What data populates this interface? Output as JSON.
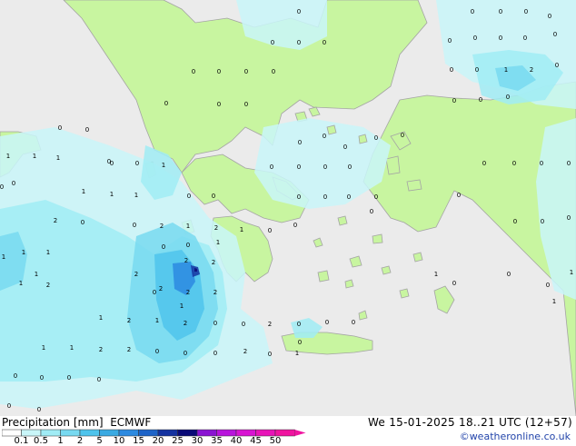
{
  "title": "Precipitation [mm]",
  "model": "ECMWF",
  "datetime": "We 15-01-2025 18..21 UTC (12+57)",
  "credit": "©weatheronline.co.uk",
  "colors": {
    "sea": "#ebebeb",
    "land": "#c8f5a0",
    "coast": "#a4a4a4",
    "prec_levels": [
      "#ffffff",
      "#c9f6f9",
      "#a0ecf5",
      "#78d9f0",
      "#4fc4ec",
      "#3aaae2",
      "#2c8ae0",
      "#1e64c8",
      "#1432a0",
      "#0a0a78",
      "#8a14d2",
      "#b814dc",
      "#d814d2",
      "#e814b8",
      "#f014a0"
    ]
  },
  "legend": {
    "labels": [
      "0.1",
      "0.5",
      "1",
      "2",
      "5",
      "10",
      "15",
      "20",
      "25",
      "30",
      "35",
      "40",
      "45",
      "50"
    ]
  },
  "map_values": {
    "marks": [
      "0",
      "0",
      "0",
      "0",
      "0",
      "0",
      "0",
      "0",
      "0",
      "0",
      "0",
      "0",
      "0",
      "0",
      "0",
      "0",
      "0",
      "0",
      "0",
      "1",
      "2",
      "0",
      "0",
      "0",
      "0",
      "0",
      "0",
      "0",
      "0",
      "0",
      "0",
      "0",
      "0",
      "0",
      "0",
      "0",
      "0",
      "0",
      "0",
      "0",
      "0",
      "0",
      "0",
      "0",
      "0",
      "0",
      "0",
      "0",
      "1",
      "1",
      "0",
      "0",
      "1",
      "1",
      "1",
      "0",
      "1",
      "0",
      "0",
      "2",
      "1",
      "2",
      "1",
      "0",
      "0",
      "2",
      "0",
      "0",
      "0",
      "0",
      "0",
      "1",
      "1",
      "1",
      "1",
      "2",
      "2",
      "2",
      "2",
      "2",
      "2",
      "0",
      "2",
      "1",
      "2",
      "1",
      "2",
      "0",
      "0",
      "0",
      "0",
      "0",
      "1",
      "1",
      "1",
      "2",
      "2",
      "0",
      "0",
      "0",
      "0",
      "1",
      "0",
      "0",
      "0",
      "0",
      "0",
      "0",
      "0",
      "1",
      "0",
      "0",
      "0",
      "0",
      "1",
      "0",
      "1",
      "0",
      "1",
      "0",
      "2",
      "2",
      "0",
      "1",
      "1"
    ]
  }
}
